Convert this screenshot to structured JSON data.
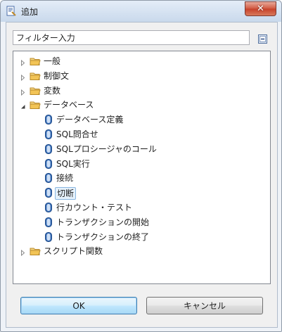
{
  "window": {
    "title": "追加",
    "close_glyph": "✕"
  },
  "filter": {
    "placeholder": "フィルター入力",
    "value": "フィルター入力"
  },
  "tree": {
    "categories": [
      {
        "label": "一般",
        "expanded": false
      },
      {
        "label": "制御文",
        "expanded": false
      },
      {
        "label": "変数",
        "expanded": false
      },
      {
        "label": "データベース",
        "expanded": true
      },
      {
        "label": "スクリプト関数",
        "expanded": false
      }
    ],
    "database_items": [
      {
        "label": "データベース定義",
        "selected": false
      },
      {
        "label": "SQL問合せ",
        "selected": false
      },
      {
        "label": "SQLプロシージャのコール",
        "selected": false
      },
      {
        "label": "SQL実行",
        "selected": false
      },
      {
        "label": "接続",
        "selected": false
      },
      {
        "label": "切断",
        "selected": true
      },
      {
        "label": "行カウント・テスト",
        "selected": false
      },
      {
        "label": "トランザクションの開始",
        "selected": false
      },
      {
        "label": "トランザクションの終了",
        "selected": false
      }
    ]
  },
  "buttons": {
    "ok": "OK",
    "cancel": "キャンセル"
  },
  "colors": {
    "folder": "#e8b64a",
    "db_icon": "#3a6fb8",
    "selection_bg": "#e5f1fb",
    "selection_border": "#8ab6e0"
  }
}
